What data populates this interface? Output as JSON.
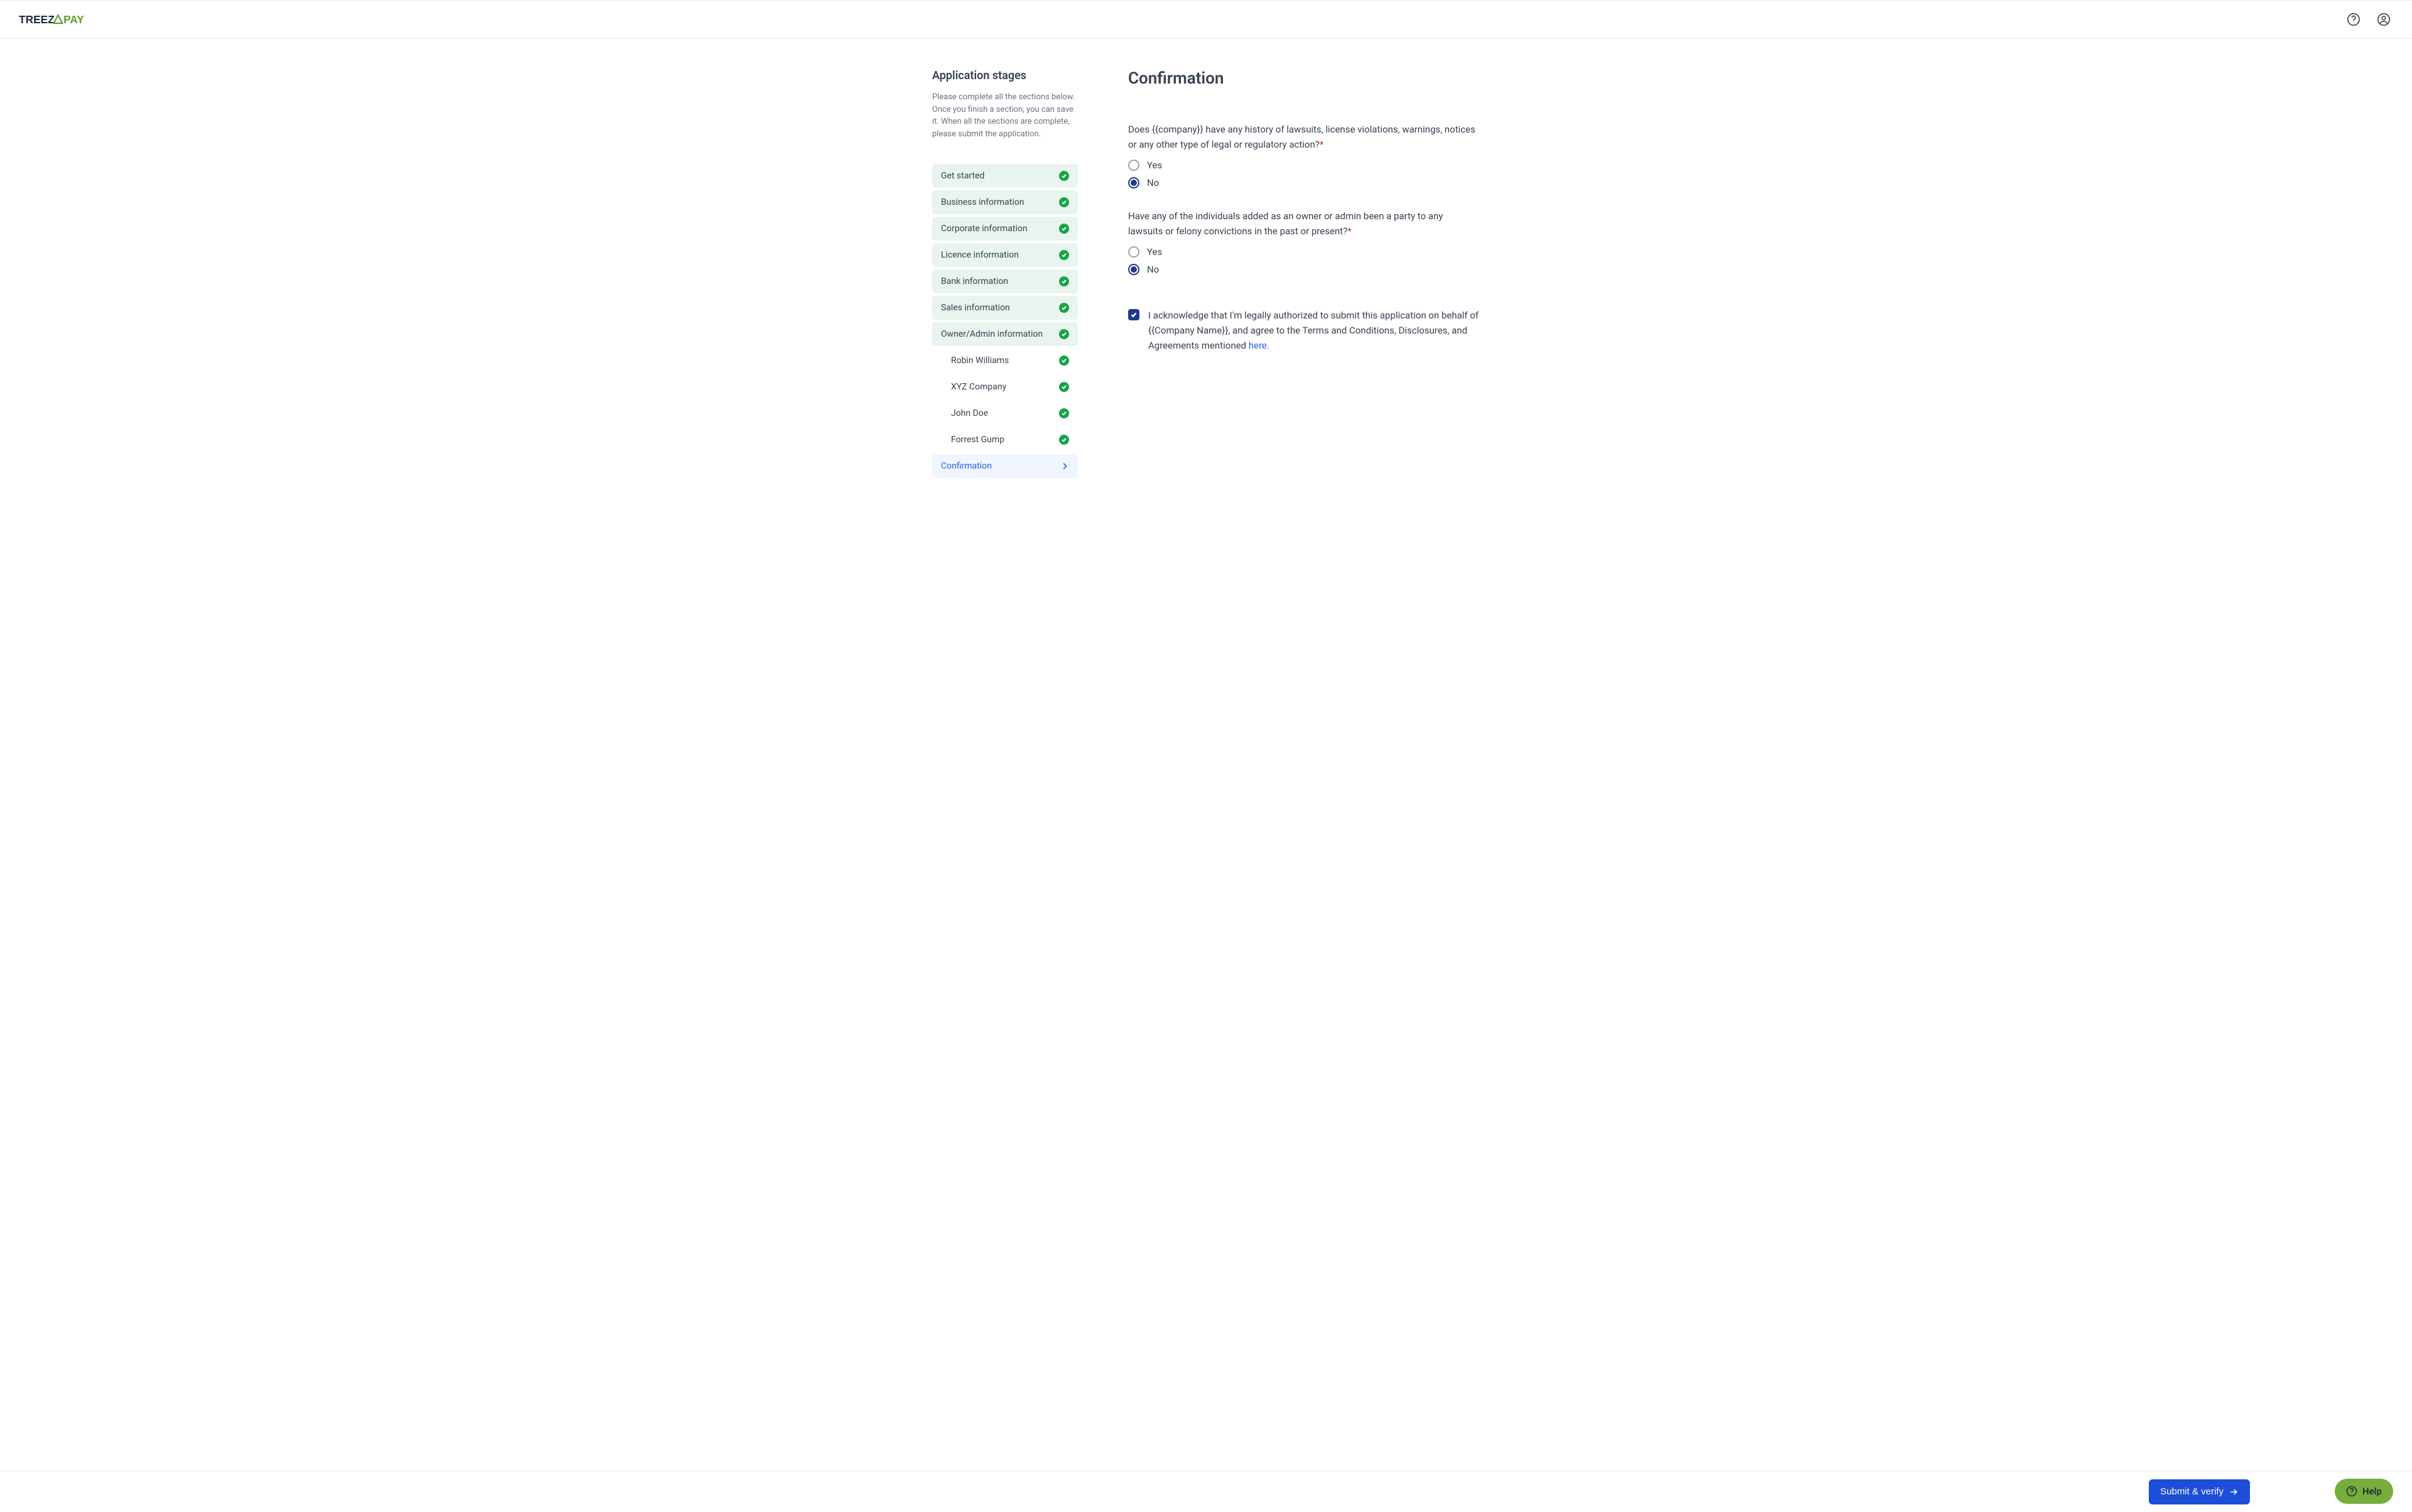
{
  "header": {
    "brand_part1": "TREEZ",
    "brand_part2": "PAY"
  },
  "sidebar": {
    "title": "Application stages",
    "description": "Please complete all the sections below. Once you finish a section, you can save it. When all the sections are complete, please submit the application.",
    "stages": [
      {
        "label": "Get started",
        "status": "done"
      },
      {
        "label": "Business information",
        "status": "done"
      },
      {
        "label": "Corporate information",
        "status": "done"
      },
      {
        "label": "Licence information",
        "status": "done"
      },
      {
        "label": "Bank information",
        "status": "done"
      },
      {
        "label": "Sales information",
        "status": "done"
      },
      {
        "label": "Owner/Admin information",
        "status": "done"
      }
    ],
    "owners": [
      {
        "label": "Robin Williams",
        "status": "done"
      },
      {
        "label": "XYZ Company",
        "status": "done"
      },
      {
        "label": "John Doe",
        "status": "done"
      },
      {
        "label": "Forrest Gump",
        "status": "done"
      }
    ],
    "confirmation_label": "Confirmation"
  },
  "content": {
    "title": "Confirmation",
    "q1": {
      "text": "Does {{company}} have any history of lawsuits, license violations, warnings, notices or any other type of legal or regulatory action?",
      "yes": "Yes",
      "no": "No",
      "selected": "no"
    },
    "q2": {
      "text": "Have any of the individuals added as an owner or admin been a party to any lawsuits or felony convictions in the past or present?",
      "yes": "Yes",
      "no": "No",
      "selected": "no"
    },
    "ack": {
      "checked": true,
      "text_part1": "I acknowledge that I'm legally authorized to submit this application on behalf of {{Company Name}}, and agree to the Terms and Conditions, Disclosures, and Agreements mentioned ",
      "link_text": "here."
    }
  },
  "footer": {
    "submit_label": "Submit & verify"
  },
  "help": {
    "label": "Help"
  }
}
